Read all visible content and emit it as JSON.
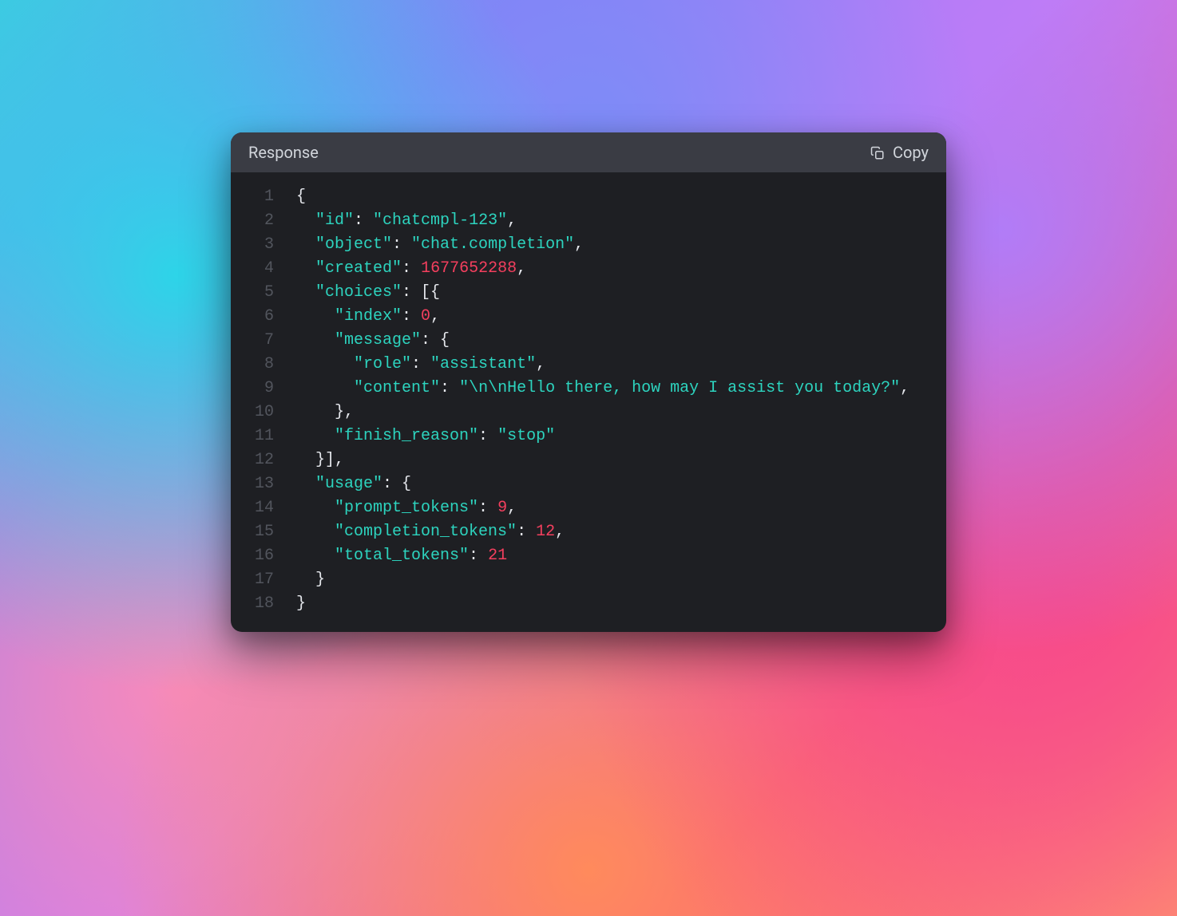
{
  "header": {
    "title": "Response",
    "copyLabel": "Copy"
  },
  "code": {
    "lines": [
      {
        "n": "1",
        "tokens": [
          {
            "t": "punc",
            "v": "{"
          }
        ]
      },
      {
        "n": "2",
        "tokens": [
          {
            "t": "punc",
            "v": "  "
          },
          {
            "t": "key",
            "v": "\"id\""
          },
          {
            "t": "punc",
            "v": ": "
          },
          {
            "t": "str",
            "v": "\"chatcmpl-123\""
          },
          {
            "t": "punc",
            "v": ","
          }
        ]
      },
      {
        "n": "3",
        "tokens": [
          {
            "t": "punc",
            "v": "  "
          },
          {
            "t": "key",
            "v": "\"object\""
          },
          {
            "t": "punc",
            "v": ": "
          },
          {
            "t": "str",
            "v": "\"chat.completion\""
          },
          {
            "t": "punc",
            "v": ","
          }
        ]
      },
      {
        "n": "4",
        "tokens": [
          {
            "t": "punc",
            "v": "  "
          },
          {
            "t": "key",
            "v": "\"created\""
          },
          {
            "t": "punc",
            "v": ": "
          },
          {
            "t": "num",
            "v": "1677652288"
          },
          {
            "t": "punc",
            "v": ","
          }
        ]
      },
      {
        "n": "5",
        "tokens": [
          {
            "t": "punc",
            "v": "  "
          },
          {
            "t": "key",
            "v": "\"choices\""
          },
          {
            "t": "punc",
            "v": ": [{"
          }
        ]
      },
      {
        "n": "6",
        "tokens": [
          {
            "t": "punc",
            "v": "    "
          },
          {
            "t": "key",
            "v": "\"index\""
          },
          {
            "t": "punc",
            "v": ": "
          },
          {
            "t": "num",
            "v": "0"
          },
          {
            "t": "punc",
            "v": ","
          }
        ]
      },
      {
        "n": "7",
        "tokens": [
          {
            "t": "punc",
            "v": "    "
          },
          {
            "t": "key",
            "v": "\"message\""
          },
          {
            "t": "punc",
            "v": ": {"
          }
        ]
      },
      {
        "n": "8",
        "tokens": [
          {
            "t": "punc",
            "v": "      "
          },
          {
            "t": "key",
            "v": "\"role\""
          },
          {
            "t": "punc",
            "v": ": "
          },
          {
            "t": "str",
            "v": "\"assistant\""
          },
          {
            "t": "punc",
            "v": ","
          }
        ]
      },
      {
        "n": "9",
        "tokens": [
          {
            "t": "punc",
            "v": "      "
          },
          {
            "t": "key",
            "v": "\"content\""
          },
          {
            "t": "punc",
            "v": ": "
          },
          {
            "t": "str",
            "v": "\"\\n\\nHello there, how may I assist you today?\""
          },
          {
            "t": "punc",
            "v": ","
          }
        ]
      },
      {
        "n": "10",
        "tokens": [
          {
            "t": "punc",
            "v": "    },"
          }
        ]
      },
      {
        "n": "11",
        "tokens": [
          {
            "t": "punc",
            "v": "    "
          },
          {
            "t": "key",
            "v": "\"finish_reason\""
          },
          {
            "t": "punc",
            "v": ": "
          },
          {
            "t": "str",
            "v": "\"stop\""
          }
        ]
      },
      {
        "n": "12",
        "tokens": [
          {
            "t": "punc",
            "v": "  }],"
          }
        ]
      },
      {
        "n": "13",
        "tokens": [
          {
            "t": "punc",
            "v": "  "
          },
          {
            "t": "key",
            "v": "\"usage\""
          },
          {
            "t": "punc",
            "v": ": {"
          }
        ]
      },
      {
        "n": "14",
        "tokens": [
          {
            "t": "punc",
            "v": "    "
          },
          {
            "t": "key",
            "v": "\"prompt_tokens\""
          },
          {
            "t": "punc",
            "v": ": "
          },
          {
            "t": "num",
            "v": "9"
          },
          {
            "t": "punc",
            "v": ","
          }
        ]
      },
      {
        "n": "15",
        "tokens": [
          {
            "t": "punc",
            "v": "    "
          },
          {
            "t": "key",
            "v": "\"completion_tokens\""
          },
          {
            "t": "punc",
            "v": ": "
          },
          {
            "t": "num",
            "v": "12"
          },
          {
            "t": "punc",
            "v": ","
          }
        ]
      },
      {
        "n": "16",
        "tokens": [
          {
            "t": "punc",
            "v": "    "
          },
          {
            "t": "key",
            "v": "\"total_tokens\""
          },
          {
            "t": "punc",
            "v": ": "
          },
          {
            "t": "num",
            "v": "21"
          }
        ]
      },
      {
        "n": "17",
        "tokens": [
          {
            "t": "punc",
            "v": "  }"
          }
        ]
      },
      {
        "n": "18",
        "tokens": [
          {
            "t": "punc",
            "v": "}"
          }
        ]
      }
    ]
  }
}
